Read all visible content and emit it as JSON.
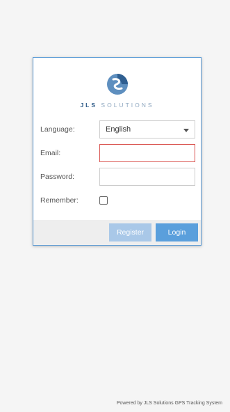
{
  "logo": {
    "brand_bold": "JLS",
    "brand_rest": "SOLUTIONS"
  },
  "form": {
    "language_label": "Language:",
    "language_value": "English",
    "email_label": "Email:",
    "email_value": "",
    "password_label": "Password:",
    "password_value": "",
    "remember_label": "Remember:",
    "remember_checked": false
  },
  "buttons": {
    "register_label": "Register",
    "login_label": "Login"
  },
  "footer": {
    "powered_by": "Powered by JLS Solutions GPS Tracking System"
  },
  "colors": {
    "accent": "#5a9fdc",
    "register_disabled": "#a9c8e8",
    "error_border": "#d9534f"
  }
}
